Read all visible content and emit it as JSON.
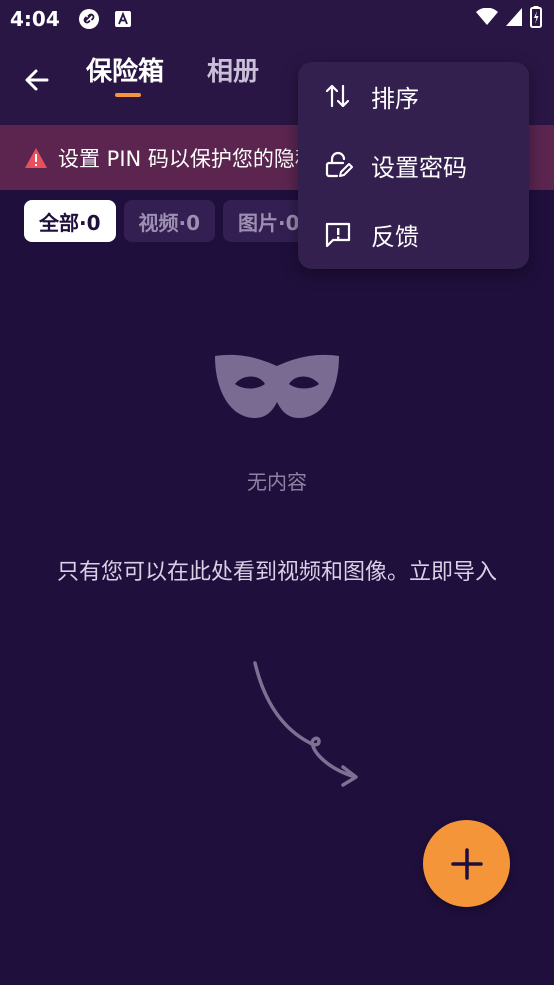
{
  "status_bar": {
    "time": "4:04",
    "icons": [
      "link-icon",
      "font-icon",
      "wifi-icon",
      "signal-icon",
      "battery-icon"
    ]
  },
  "tabs": {
    "vault": "保险箱",
    "album": "相册"
  },
  "banner": {
    "text": "设置 PIN 码以保护您的隐私"
  },
  "filters": [
    {
      "label": "全部·0",
      "active": true
    },
    {
      "label": "视频·0",
      "active": false
    },
    {
      "label": "图片·0",
      "active": false
    }
  ],
  "menu": {
    "items": [
      {
        "label": "排序",
        "icon": "sort-icon"
      },
      {
        "label": "设置密码",
        "icon": "lock-edit-icon"
      },
      {
        "label": "反馈",
        "icon": "feedback-icon"
      }
    ]
  },
  "empty": {
    "title": "无内容",
    "description": "只有您可以在此处看到视频和图像。立即导入"
  },
  "colors": {
    "background": "#1f0f3c",
    "accent": "#f5953a",
    "banner": "#5b2550",
    "menu": "#34204f"
  }
}
